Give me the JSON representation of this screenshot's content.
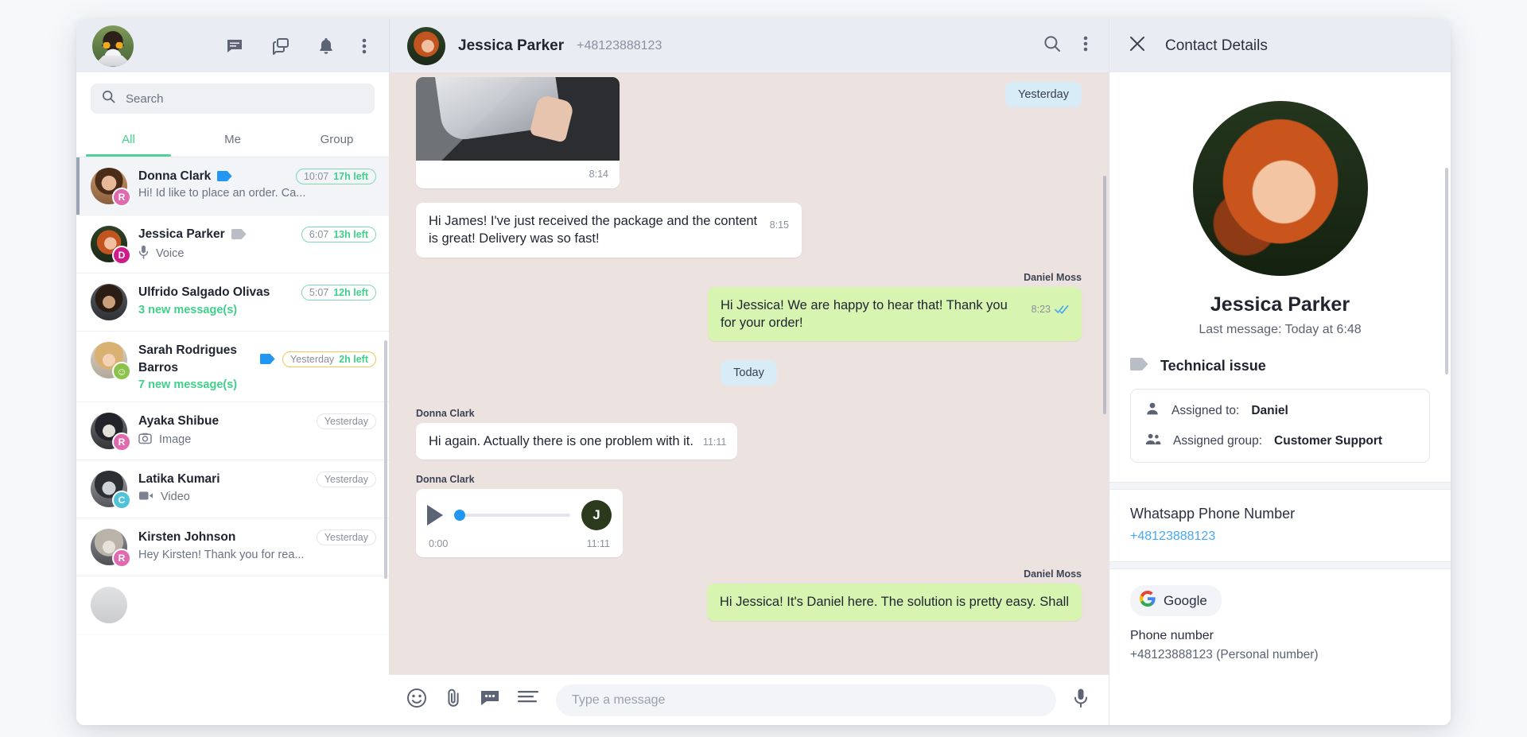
{
  "sidebar": {
    "icons": [
      "chat-icon",
      "copy-icon",
      "bell-icon",
      "more-vertical-icon"
    ],
    "search": {
      "placeholder": "Search",
      "value": ""
    },
    "tabs": [
      {
        "label": "All",
        "active": true
      },
      {
        "label": "Me",
        "active": false
      },
      {
        "label": "Group",
        "active": false
      }
    ],
    "chats": [
      {
        "name": "Donna Clark",
        "tag_color": "#2196f3",
        "has_tag": true,
        "time": "10:07",
        "left": "17h left",
        "badge_style": "green",
        "preview": "Hi! Id like to place an order. Ca...",
        "preview_icon": "",
        "preview_style": "normal",
        "initial": "R",
        "initial_color": "#e06ab0",
        "selected": true
      },
      {
        "name": "Jessica Parker",
        "tag_color": "#b9bdc6",
        "has_tag": true,
        "time": "6:07",
        "left": "13h left",
        "badge_style": "green",
        "preview": "Voice",
        "preview_icon": "mic-icon",
        "preview_style": "normal",
        "initial": "D",
        "initial_color": "#d01a8a",
        "selected": false
      },
      {
        "name": "Ulfrido Salgado Olivas",
        "tag_color": "",
        "has_tag": false,
        "time": "5:07",
        "left": "12h left",
        "badge_style": "green",
        "preview": "3 new message(s)",
        "preview_icon": "",
        "preview_style": "green",
        "initial": "",
        "initial_color": "",
        "selected": false
      },
      {
        "name": "Sarah Rodrigues Barros",
        "tag_color": "#2196f3",
        "has_tag": true,
        "time": "Yesterday",
        "left": "2h left",
        "badge_style": "warn",
        "preview": "7 new message(s)",
        "preview_icon": "",
        "preview_style": "green",
        "initial": "☺",
        "initial_color": "#8bc34a",
        "selected": false
      },
      {
        "name": "Ayaka Shibue",
        "tag_color": "",
        "has_tag": false,
        "time": "Yesterday",
        "left": "",
        "badge_style": "plain",
        "preview": "Image",
        "preview_icon": "image-icon",
        "preview_style": "normal",
        "initial": "R",
        "initial_color": "#e06ab0",
        "selected": false
      },
      {
        "name": "Latika Kumari",
        "tag_color": "",
        "has_tag": false,
        "time": "Yesterday",
        "left": "",
        "badge_style": "plain",
        "preview": "Video",
        "preview_icon": "video-icon",
        "preview_style": "normal",
        "initial": "C",
        "initial_color": "#4fc3d9",
        "selected": false
      },
      {
        "name": "Kirsten Johnson",
        "tag_color": "",
        "has_tag": false,
        "time": "Yesterday",
        "left": "",
        "badge_style": "plain",
        "preview": "Hey Kirsten! Thank you for rea...",
        "preview_icon": "",
        "preview_style": "normal",
        "initial": "R",
        "initial_color": "#e06ab0",
        "selected": false
      }
    ]
  },
  "chat": {
    "contact_name": "Jessica Parker",
    "contact_phone": "+48123888123",
    "search_icon": "search-icon",
    "more_icon": "more-vertical-icon",
    "messages": {
      "day_yesterday": "Yesterday",
      "day_today": "Today",
      "image_time": "8:14",
      "m1_text": "Hi James! I've just received the package and the content is great! Delivery was so fast!",
      "m1_time": "8:15",
      "m2_sender": "Daniel Moss",
      "m2_text": "Hi Jessica! We are happy to hear that! Thank you for your order!",
      "m2_time": "8:23",
      "m3_sender": "Donna Clark",
      "m3_text": "Hi again. Actually there is one problem with it.",
      "m3_time": "11:11",
      "m4_sender": "Donna Clark",
      "audio_current": "0:00",
      "audio_time": "11:11",
      "audio_initial": "J",
      "m5_sender": "Daniel Moss",
      "m5_text": "Hi Jessica! It's Daniel here. The solution is pretty easy. Shall"
    },
    "composer": {
      "placeholder": "Type a message",
      "value": "",
      "icons": [
        "emoji-icon",
        "attachment-icon",
        "quick-reply-icon",
        "template-icon",
        "mic-icon"
      ]
    }
  },
  "details": {
    "title": "Contact Details",
    "close_icon": "close-icon",
    "name": "Jessica Parker",
    "last_message": "Last message: Today at 6:48",
    "tag_label": "Technical issue",
    "assigned_to_label": "Assigned to:",
    "assigned_to_value": "Daniel",
    "assigned_group_label": "Assigned group:",
    "assigned_group_value": "Customer Support",
    "phone_section_title": "Whatsapp Phone Number",
    "phone_value": "+48123888123",
    "google_label": "Google",
    "google_phone_title": "Phone number",
    "google_phone_value": "+48123888123",
    "google_phone_note": "(Personal number)"
  }
}
